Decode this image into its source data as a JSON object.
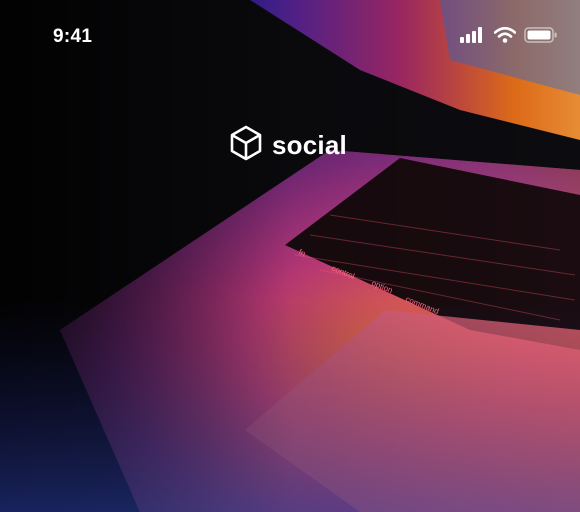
{
  "status_bar": {
    "time": "9:41",
    "icons": [
      "signal-icon",
      "wifi-icon",
      "battery-icon"
    ]
  },
  "brand": {
    "logo_icon": "cube-logo-icon",
    "name": "social"
  },
  "background": {
    "description_icon": "laptop-keyboard-photo",
    "accent_colors": [
      "#ff3a2e",
      "#ff7a1a",
      "#e0389a",
      "#6b2cc4",
      "#2a2f8f"
    ]
  },
  "keyboard": {
    "keys": [
      "fn",
      "control",
      "option",
      "command"
    ]
  }
}
